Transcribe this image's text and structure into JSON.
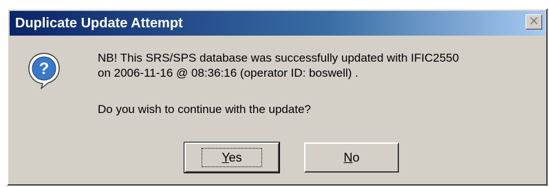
{
  "dialog": {
    "title": "Duplicate Update Attempt",
    "close_symbol": "✕",
    "message_line1": "NB! This SRS/SPS database was successfully updated with IFIC2550",
    "message_line2": "on 2006-11-16 @ 08:36:16 (operator ID: boswell) .",
    "question": "Do you wish to continue with the update?",
    "icon": "question-mark-balloon-icon",
    "buttons": {
      "yes_access_key": "Y",
      "yes_rest": "es",
      "no_access_key": "N",
      "no_rest": "o"
    }
  },
  "colors": {
    "titlebar_start": "#0a246a",
    "titlebar_end": "#a6caf0",
    "dialog_background": "#d4d0c8",
    "icon_fill": "#3a78c8"
  }
}
